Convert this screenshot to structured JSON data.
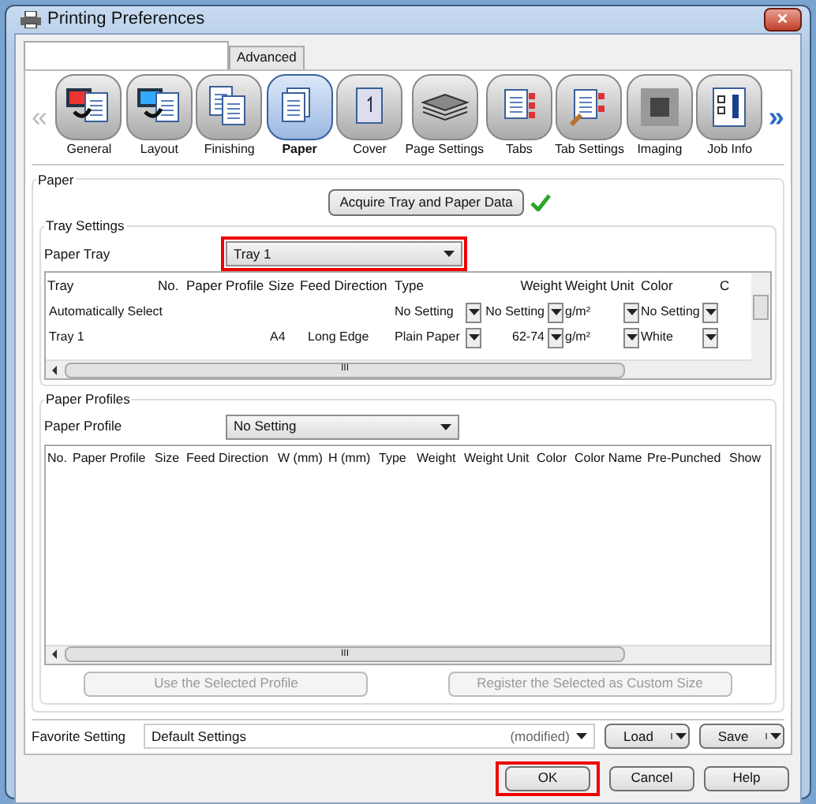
{
  "window": {
    "title": "Printing Preferences",
    "close": "✕"
  },
  "tabs": [
    {
      "selected": true
    },
    {
      "label": "Advanced",
      "selected": false
    }
  ],
  "nav": {
    "prev": "«",
    "next": "»",
    "items": [
      {
        "label": "General",
        "selected": false
      },
      {
        "label": "Layout",
        "selected": false
      },
      {
        "label": "Finishing",
        "selected": false
      },
      {
        "label": "Paper",
        "selected": true
      },
      {
        "label": "Cover",
        "selected": false
      },
      {
        "label": "Page Settings",
        "selected": false
      },
      {
        "label": "Tabs",
        "selected": false
      },
      {
        "label": "Tab Settings",
        "selected": false
      },
      {
        "label": "Imaging",
        "selected": false
      },
      {
        "label": "Job Info",
        "selected": false
      }
    ]
  },
  "paper": {
    "title": "Paper",
    "acquire_button": "Acquire Tray and Paper Data",
    "acquired": true,
    "tray_settings": {
      "title": "Tray Settings",
      "label": "Paper Tray",
      "value": "Tray 1",
      "highlighted": true,
      "columns": [
        "Tray",
        "No.",
        "Paper Profile",
        "Size",
        "Feed Direction",
        "Type",
        "Weight",
        "Weight Unit",
        "Color",
        "C"
      ],
      "rows": [
        [
          {
            "kind": "text",
            "value": "Automatically Select"
          },
          {
            "kind": "text"
          },
          {
            "kind": "text"
          },
          {
            "kind": "text"
          },
          {
            "kind": "text"
          },
          {
            "kind": "dropdown",
            "value": "No Setting"
          },
          {
            "kind": "dropdown",
            "value": "No Setting"
          },
          {
            "kind": "dropdown",
            "value": "g/m²"
          },
          {
            "kind": "dropdown",
            "value": "No Setting"
          },
          {
            "kind": "text"
          }
        ],
        [
          {
            "kind": "text",
            "value": "Tray 1"
          },
          {
            "kind": "text"
          },
          {
            "kind": "text"
          },
          {
            "kind": "text",
            "value": "A4"
          },
          {
            "kind": "text",
            "value": "Long Edge"
          },
          {
            "kind": "dropdown",
            "value": "Plain Paper"
          },
          {
            "kind": "dropdown",
            "value": "62-74"
          },
          {
            "kind": "dropdown",
            "value": "g/m²"
          },
          {
            "kind": "dropdown",
            "value": "White"
          },
          {
            "kind": "text"
          }
        ]
      ],
      "scroll_mark": "III"
    },
    "profiles": {
      "title": "Paper Profiles",
      "label": "Paper Profile",
      "value": "No Setting",
      "columns": [
        "No.",
        "Paper Profile",
        "Size",
        "Feed Direction",
        "W (mm)",
        "H (mm)",
        "Type",
        "Weight",
        "Weight Unit",
        "Color",
        "Color Name",
        "Pre-Punched",
        "Show"
      ],
      "scroll_mark": "III",
      "buttons": [
        {
          "label": "Use the Selected Profile",
          "disabled": true
        },
        {
          "label": "Register the Selected as Custom Size",
          "disabled": true
        }
      ]
    }
  },
  "favorite": {
    "label": "Favorite Setting",
    "value": "Default Settings",
    "status": "(modified)",
    "buttons": [
      "Load",
      "Save"
    ]
  },
  "buttons": [
    {
      "label": "OK",
      "highlighted": true
    },
    {
      "label": "Cancel",
      "highlighted": false
    },
    {
      "label": "Help",
      "highlighted": false
    }
  ]
}
